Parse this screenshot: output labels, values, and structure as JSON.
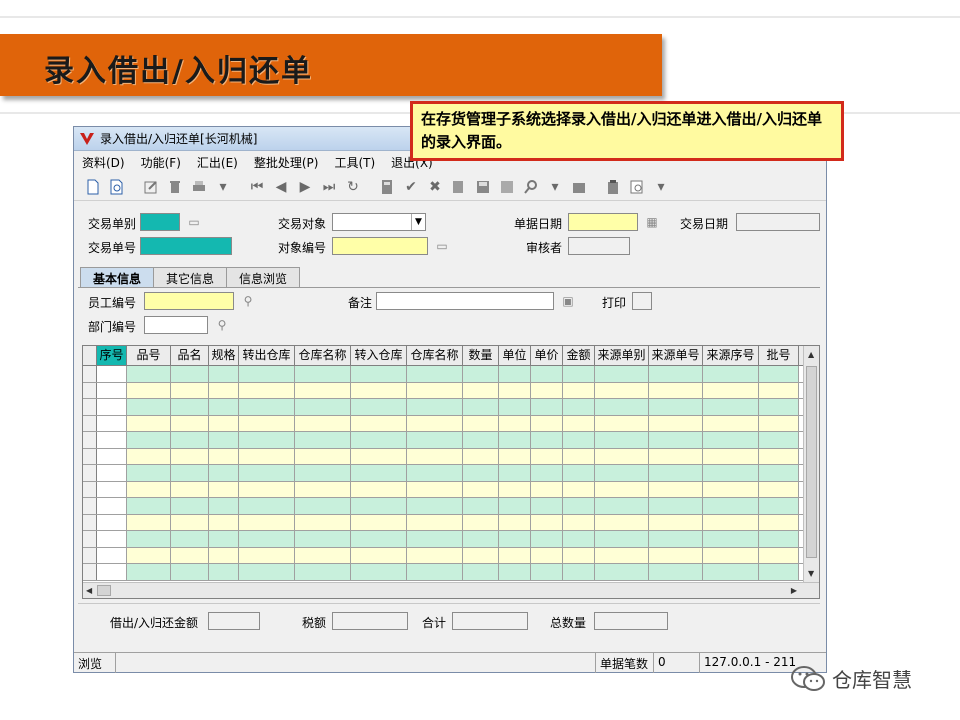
{
  "banner": {
    "title": "录入借出/入归还单"
  },
  "callout": {
    "text": "在存货管理子系统选择录入借出/入归还单进入借出/入归还单的录入界面。"
  },
  "window": {
    "title": "录入借出/入归还单[长河机械]",
    "menu": [
      "资料(D)",
      "功能(F)",
      "汇出(E)",
      "整批处理(P)",
      "工具(T)",
      "退出(X)"
    ]
  },
  "form": {
    "trade_type_label": "交易单别",
    "trade_no_label": "交易单号",
    "trade_object_label": "交易对象",
    "object_code_label": "对象编号",
    "doc_date_label": "单据日期",
    "reviewer_label": "审核者",
    "trade_date_label": "交易日期"
  },
  "tabs": [
    "基本信息",
    "其它信息",
    "信息浏览"
  ],
  "basic": {
    "employee_label": "员工编号",
    "dept_label": "部门编号",
    "remark_label": "备注",
    "print_label": "打印"
  },
  "grid": {
    "columns": [
      "序号",
      "品号",
      "品名",
      "规格",
      "转出仓库",
      "仓库名称",
      "转入仓库",
      "仓库名称",
      "数量",
      "单位",
      "单价",
      "金额",
      "来源单别",
      "来源单号",
      "来源序号",
      "批号"
    ]
  },
  "footer": {
    "amount_label": "借出/入归还金额",
    "tax_label": "税额",
    "total_label": "合计",
    "qty_label": "总数量"
  },
  "status": {
    "mode": "浏览",
    "count_label": "单据笔数",
    "count_value": "0",
    "server": "127.0.0.1 - 211"
  },
  "watermark": {
    "text": "仓库智慧"
  },
  "colors": {
    "banner": "#e0640a",
    "callout_border": "#d22a1a",
    "teal": "#14b8b0",
    "row_green": "#c8f0dc",
    "row_yellow": "#ffffd6"
  }
}
